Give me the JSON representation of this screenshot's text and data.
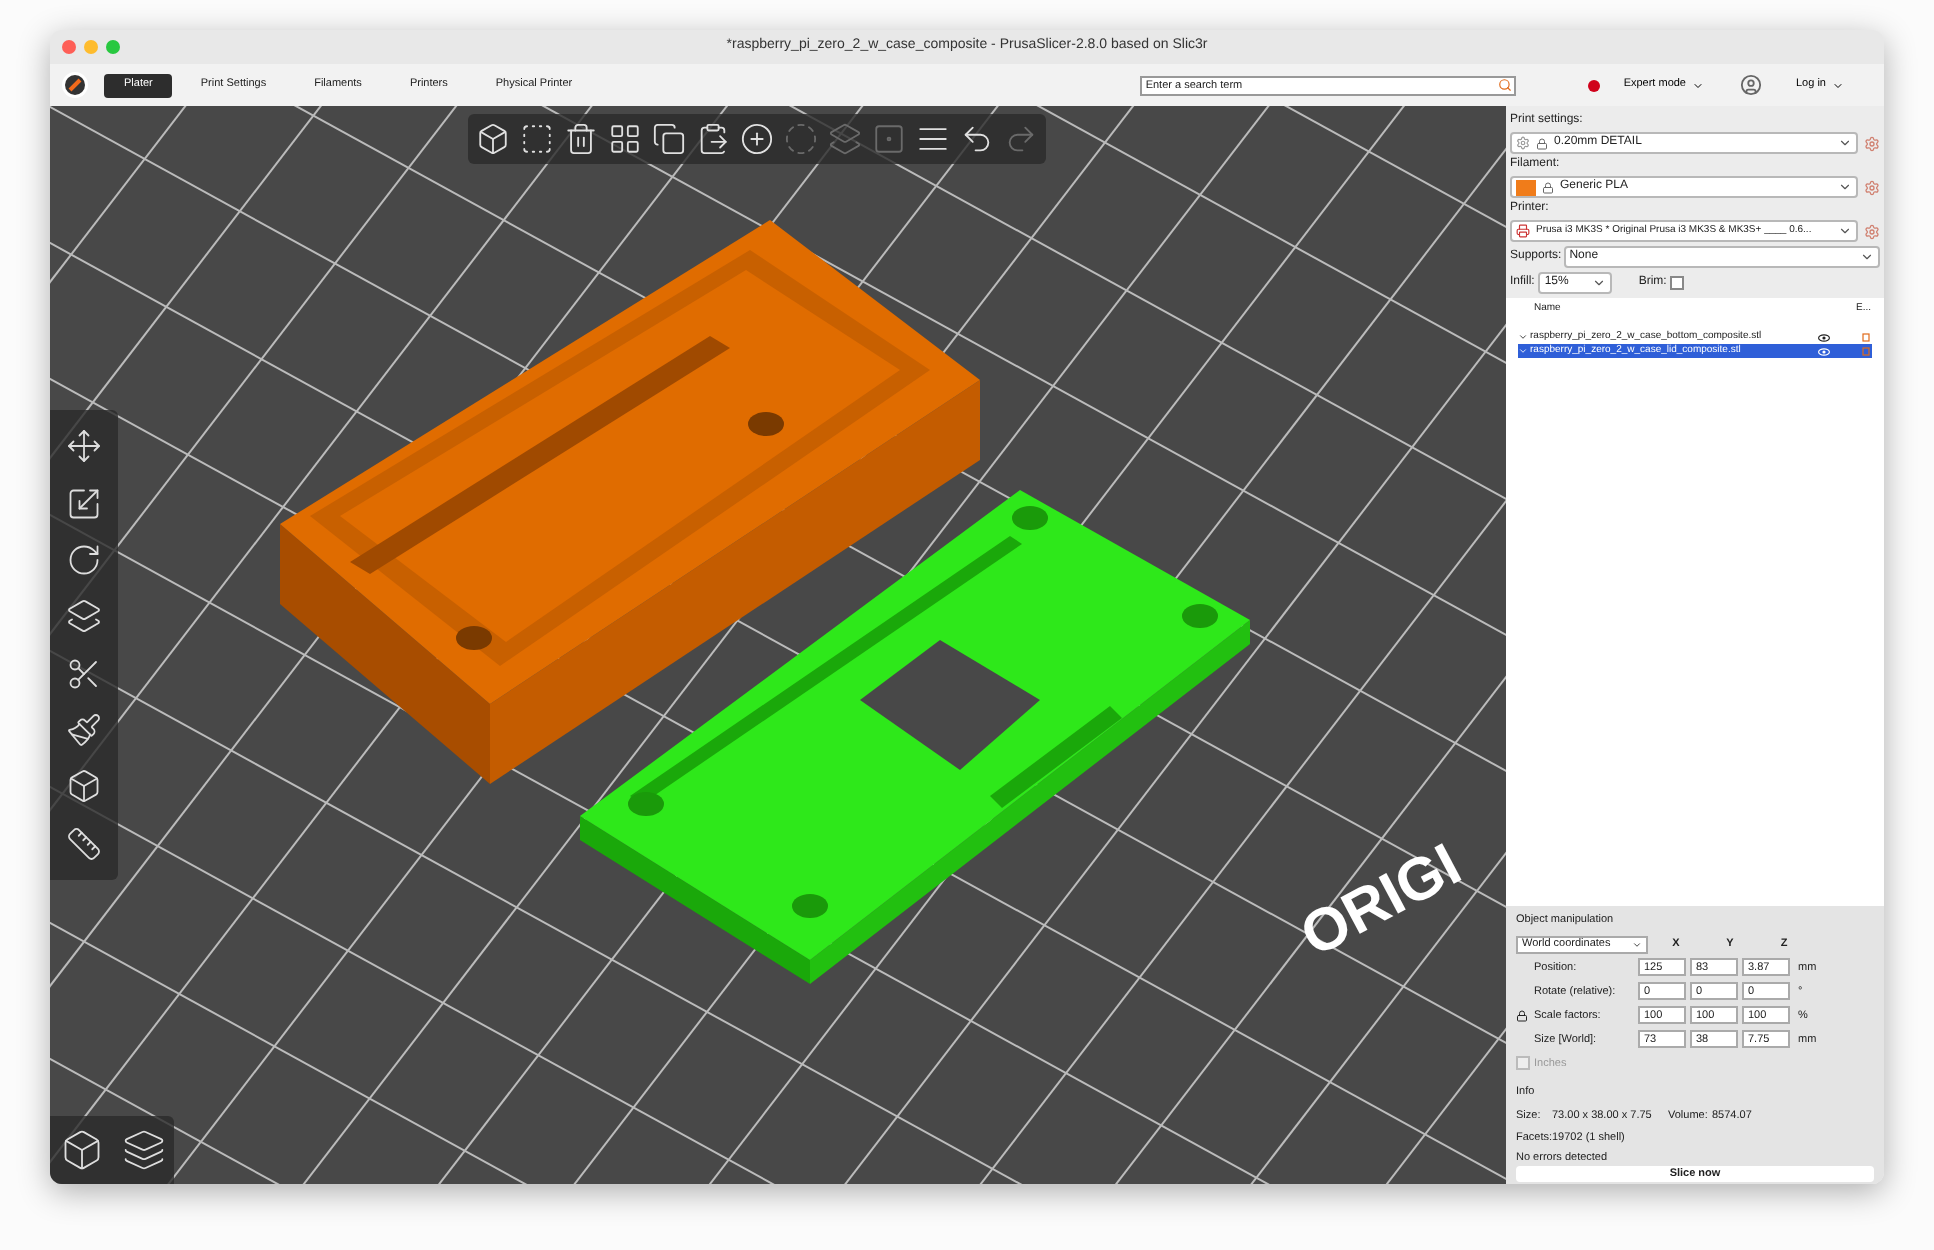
{
  "window": {
    "title": "*raspberry_pi_zero_2_w_case_composite - PrusaSlicer-2.8.0 based on Slic3r"
  },
  "tabs": [
    {
      "label": "Plater",
      "selected": true
    },
    {
      "label": "Print Settings",
      "selected": false
    },
    {
      "label": "Filaments",
      "selected": false
    },
    {
      "label": "Printers",
      "selected": false
    },
    {
      "label": "Physical Printer",
      "selected": false
    }
  ],
  "search": {
    "placeholder": "Enter a search term"
  },
  "mode": {
    "label": "Expert mode"
  },
  "login": {
    "label": "Log in"
  },
  "toolbar": [
    {
      "kind": "add",
      "disabled": false
    },
    {
      "kind": "delete",
      "disabled": false
    },
    {
      "kind": "delete_all",
      "disabled": false
    },
    {
      "kind": "arrange",
      "disabled": false
    },
    {
      "kind": "copy",
      "disabled": false
    },
    {
      "kind": "paste",
      "disabled": false
    },
    {
      "kind": "add_instance",
      "disabled": false
    },
    {
      "kind": "remove_instance",
      "disabled": true
    },
    {
      "kind": "split_objects",
      "disabled": true
    },
    {
      "kind": "split_parts",
      "disabled": true
    },
    {
      "kind": "layers",
      "disabled": false
    },
    {
      "kind": "undo",
      "disabled": false
    },
    {
      "kind": "redo",
      "disabled": true
    }
  ],
  "bed_label": "ORIGI",
  "print_settings": {
    "label": "Print settings:",
    "value": "0.20mm DETAIL"
  },
  "filament": {
    "label": "Filament:",
    "value": "Generic PLA"
  },
  "printer": {
    "label": "Printer:",
    "value": "Prusa i3 MK3S * Original Prusa i3 MK3S & MK3S+ ____ 0.6..."
  },
  "supports": {
    "label": "Supports:",
    "value": "None"
  },
  "infill": {
    "label": "Infill:",
    "value": "15%"
  },
  "brim": {
    "label": "Brim:",
    "checked": false
  },
  "object_list": {
    "columns": [
      "Name",
      "E..."
    ],
    "items": [
      {
        "name": "raspberry_pi_zero_2_w_case_bottom_composite.stl",
        "selected": false
      },
      {
        "name": "raspberry_pi_zero_2_w_case_lid_composite.stl",
        "selected": true
      }
    ]
  },
  "object_manipulation": {
    "title": "Object manipulation",
    "coordinates": "World coordinates",
    "axes": [
      "X",
      "Y",
      "Z"
    ],
    "rows": [
      {
        "label": "Position:",
        "values": [
          "125",
          "83",
          "3.87"
        ],
        "unit": "mm"
      },
      {
        "label": "Rotate (relative):",
        "values": [
          "0",
          "0",
          "0"
        ],
        "unit": "°"
      },
      {
        "label": "Scale factors:",
        "values": [
          "100",
          "100",
          "100"
        ],
        "unit": "%"
      },
      {
        "label": "Size [World]:",
        "values": [
          "73",
          "38",
          "7.75"
        ],
        "unit": "mm"
      }
    ],
    "inches": {
      "label": "Inches",
      "checked": false
    }
  },
  "info": {
    "title": "Info",
    "size_label": "Size:",
    "size": "73.00 x 38.00 x 7.75",
    "volume_label": "Volume:",
    "volume": "8574.07",
    "facets_label": "Facets:",
    "facets": "19702 (1 shell)",
    "status": "No errors detected"
  },
  "slice_button": "Slice now"
}
